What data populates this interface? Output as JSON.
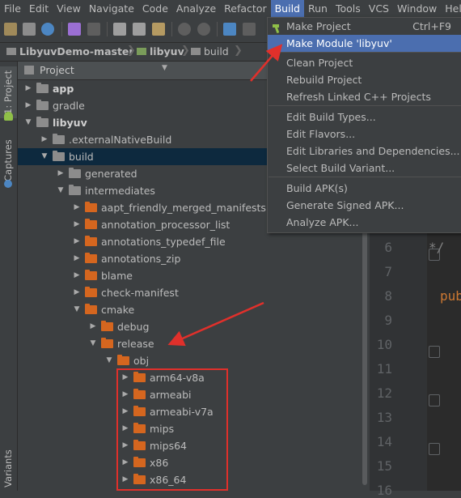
{
  "menubar": {
    "items": [
      "File",
      "Edit",
      "View",
      "Navigate",
      "Code",
      "Analyze",
      "Refactor",
      "Build",
      "Run",
      "Tools",
      "VCS",
      "Window",
      "Hel"
    ],
    "active": "Build"
  },
  "navbar": {
    "crumbs": [
      "LibyuvDemo-master",
      "libyuv",
      "build"
    ]
  },
  "sidebar": {
    "project_tab": "1: Project",
    "captures_tab": "Captures",
    "variants_tab": "Variants"
  },
  "project_panel": {
    "title": "Project"
  },
  "tree": [
    {
      "label": "app",
      "bold": true,
      "expanded": false,
      "icon": "module"
    },
    {
      "label": "gradle",
      "bold": false,
      "expanded": false,
      "icon": "grey"
    },
    {
      "label": "libyuv",
      "bold": true,
      "expanded": true,
      "icon": "module"
    },
    {
      "label": ".externalNativeBuild",
      "bold": false,
      "expanded": false,
      "icon": "grey"
    },
    {
      "label": "build",
      "bold": false,
      "expanded": true,
      "icon": "grey",
      "selected": true
    },
    {
      "label": "generated",
      "bold": false,
      "expanded": false,
      "icon": "grey"
    },
    {
      "label": "intermediates",
      "bold": false,
      "expanded": true,
      "icon": "grey"
    },
    {
      "label": "aapt_friendly_merged_manifests",
      "bold": false,
      "expanded": false,
      "icon": "orange"
    },
    {
      "label": "annotation_processor_list",
      "bold": false,
      "expanded": false,
      "icon": "orange"
    },
    {
      "label": "annotations_typedef_file",
      "bold": false,
      "expanded": false,
      "icon": "orange"
    },
    {
      "label": "annotations_zip",
      "bold": false,
      "expanded": false,
      "icon": "orange"
    },
    {
      "label": "blame",
      "bold": false,
      "expanded": false,
      "icon": "orange"
    },
    {
      "label": "check-manifest",
      "bold": false,
      "expanded": false,
      "icon": "orange"
    },
    {
      "label": "cmake",
      "bold": false,
      "expanded": true,
      "icon": "orange"
    },
    {
      "label": "debug",
      "bold": false,
      "expanded": false,
      "icon": "orange"
    },
    {
      "label": "release",
      "bold": false,
      "expanded": true,
      "icon": "orange"
    },
    {
      "label": "obj",
      "bold": false,
      "expanded": true,
      "icon": "orange"
    },
    {
      "label": "arm64-v8a",
      "bold": false,
      "expanded": false,
      "icon": "orange"
    },
    {
      "label": "armeabi",
      "bold": false,
      "expanded": false,
      "icon": "orange"
    },
    {
      "label": "armeabi-v7a",
      "bold": false,
      "expanded": false,
      "icon": "orange"
    },
    {
      "label": "mips",
      "bold": false,
      "expanded": false,
      "icon": "orange"
    },
    {
      "label": "mips64",
      "bold": false,
      "expanded": false,
      "icon": "orange"
    },
    {
      "label": "x86",
      "bold": false,
      "expanded": false,
      "icon": "orange"
    },
    {
      "label": "x86_64",
      "bold": false,
      "expanded": false,
      "icon": "orange"
    }
  ],
  "build_menu": {
    "items": [
      {
        "label": "Make Project",
        "shortcut": "Ctrl+F9",
        "icon": "hammer-icon"
      },
      {
        "label": "Make Module 'libyuv'",
        "shortcut": "",
        "highlighted": true
      },
      {
        "label": "Clean Project",
        "shortcut": ""
      },
      {
        "label": "Rebuild Project",
        "shortcut": ""
      },
      {
        "label": "Refresh Linked C++ Projects",
        "shortcut": ""
      },
      {
        "label": "Edit Build Types...",
        "shortcut": ""
      },
      {
        "label": "Edit Flavors...",
        "shortcut": ""
      },
      {
        "label": "Edit Libraries and Dependencies...",
        "shortcut": ""
      },
      {
        "label": "Select Build Variant...",
        "shortcut": ""
      },
      {
        "label": "Build APK(s)",
        "shortcut": ""
      },
      {
        "label": "Generate Signed APK...",
        "shortcut": ""
      },
      {
        "label": "Analyze APK...",
        "shortcut": ""
      }
    ]
  },
  "editor": {
    "line_numbers": [
      "6",
      "7",
      "8",
      "9",
      "10",
      "11",
      "12",
      "13",
      "14",
      "15",
      "16"
    ],
    "code_fragments": [
      "*/",
      "pub"
    ]
  },
  "colors": {
    "accent": "#4b6eaf",
    "folder_orange": "#d5661f",
    "annotation_red": "#e0302b"
  }
}
